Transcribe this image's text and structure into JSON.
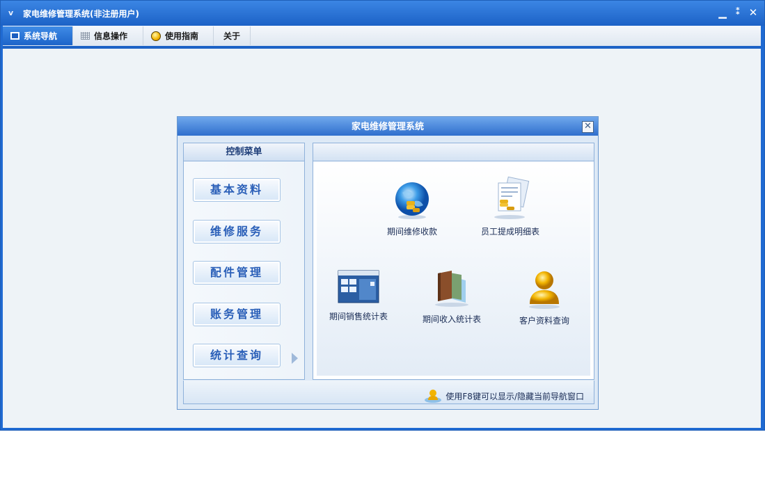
{
  "window": {
    "title": "家电维修管理系统(非注册用户)",
    "title_icon": "ⅴ"
  },
  "window_controls": [
    "minimize-icon",
    "restore-icon",
    "close-icon"
  ],
  "tabs": [
    {
      "label": "系统导航",
      "icon": "screen-icon",
      "active": true
    },
    {
      "label": "信息操作",
      "icon": "grid-icon",
      "active": false
    },
    {
      "label": "使用指南",
      "icon": "bulb-icon",
      "active": false
    },
    {
      "label": "关于",
      "icon": "",
      "active": false
    }
  ],
  "dialog": {
    "title": "家电维修管理系统",
    "menu_header": "控制菜单",
    "menu_items": [
      "基本资料",
      "维修服务",
      "配件管理",
      "账务管理",
      "统计查询"
    ],
    "selected_menu": "统计查询",
    "items": [
      {
        "label": "期间维修收款",
        "icon": "globe-coins-icon"
      },
      {
        "label": "员工提成明细表",
        "icon": "documents-coins-icon"
      },
      {
        "label": "期间销售统计表",
        "icon": "calendar-window-icon"
      },
      {
        "label": "期间收入统计表",
        "icon": "books-icon"
      },
      {
        "label": "客户资料查询",
        "icon": "user-icon"
      }
    ],
    "footer_tip": "使用F8键可以显示/隐藏当前导航窗口"
  }
}
